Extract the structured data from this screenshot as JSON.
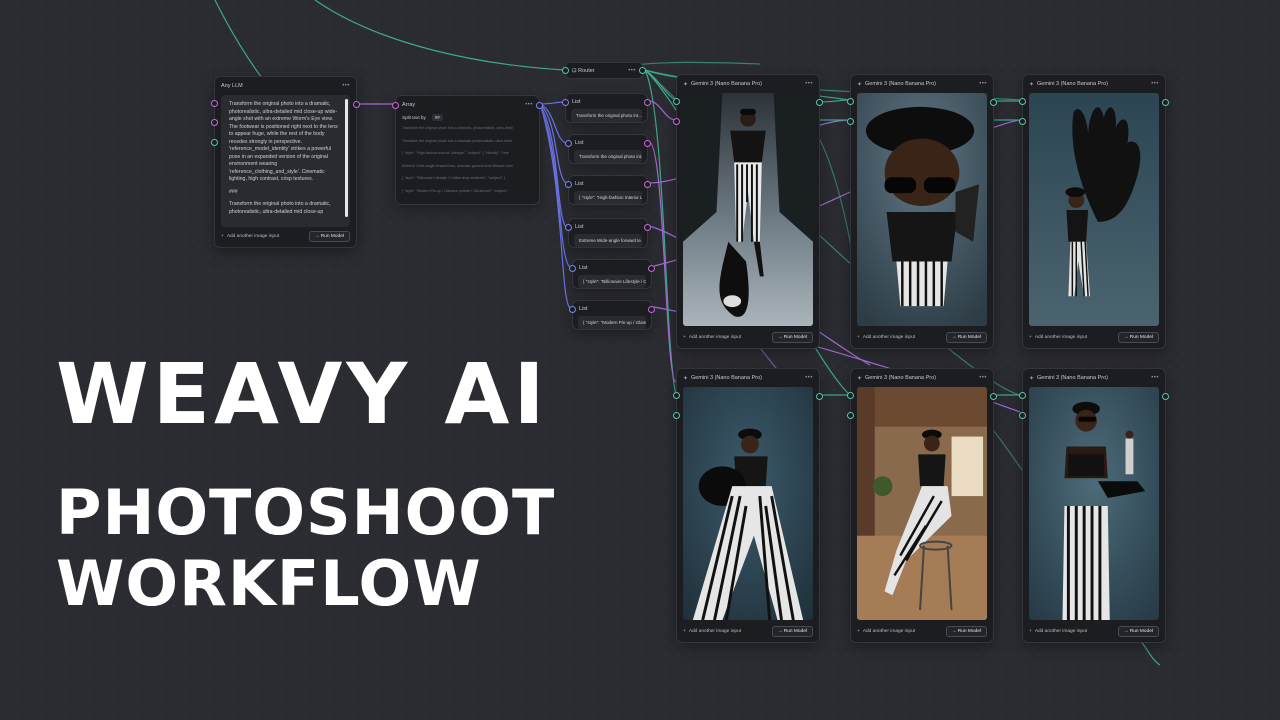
{
  "headline": {
    "line1": "WEAVY AI",
    "line2": "PHOTOSHOOT",
    "line3": "WORKFLOW"
  },
  "llm_node": {
    "title": "Any LLM",
    "paragraph1": "Transform the original photo into a dramatic, photorealistic, ultra-detailed mid close-up wide-angle shot with an extreme Worm's Eye view. The footwear is positioned right next to the lens to appear huge, while the rest of the body recedes strongly in perspective. 'reference_model_identity' strikes a powerful pose in an expanded version of the original environment wearing 'reference_clothing_and_style'. Cinematic lighting, high contrast, crisp textures.",
    "separator": "###",
    "paragraph2": "Transform the original photo into a dramatic, photorealistic, ultra-detailed mid close-up",
    "add_input": "Add another image input",
    "run_label": "Run Model",
    "menu_icon": "more-horizontal-icon"
  },
  "array_node": {
    "title": "Array",
    "split_label": "Split text by",
    "split_value": "##",
    "lines": [
      "Transform the original photo into a dramatic, photorealistic, ultra-detai",
      "Transform the original photo into a dramatic photorealistic, ultra-detai",
      "{ \"style\": \"High-fashion interior Lifestyle\", \"subject\": { \"identity\": \"refe",
      "Extreme Wide-angle forward lean, dramatic ground-level lifestyle shot",
      "{ \"style\": \"Billionaire Lifestyle / Coffee shop aesthetic\", \"subject\": {",
      "{ \"style\": \"Modern Pin-up / Glamour portrait / Old-school\", \"subject\":"
    ]
  },
  "router": {
    "title": "Router"
  },
  "list_nodes": [
    {
      "title": "List",
      "text": "Transform the original photo int..."
    },
    {
      "title": "List",
      "text": "Transform the original photo int..."
    },
    {
      "title": "List",
      "text": "{ \"style\": \"High-fashion Interior Li..."
    },
    {
      "title": "List",
      "text": "Extreme Wide-angle forward le..."
    },
    {
      "title": "List",
      "text": "{ \"style\": \"Billionaire Lifestyle / C..."
    },
    {
      "title": "List",
      "text": "{ \"style\": \"Modern Pin-up / Glam..."
    }
  ],
  "model_nodes": [
    {
      "title": "Gemini 3 (Nano Banana Pro)",
      "add_input": "Add another image input",
      "run_label": "Run Model"
    },
    {
      "title": "Gemini 3 (Nano Banana Pro)",
      "add_input": "Add another image input",
      "run_label": "Run Model"
    },
    {
      "title": "Gemini 3 (Nano Banana Pro)",
      "add_input": "Add another image input",
      "run_label": "Run Model"
    },
    {
      "title": "Gemini 3 (Nano Banana Pro)",
      "add_input": "Add another image input",
      "run_label": "Run Model"
    },
    {
      "title": "Gemini 3 (Nano Banana Pro)",
      "add_input": "Add another image input",
      "run_label": "Run Model"
    },
    {
      "title": "Gemini 3 (Nano Banana Pro)",
      "add_input": "Add another image input",
      "run_label": "Run Model"
    }
  ],
  "colors": {
    "background": "#2b2c31",
    "node": "#1c1d21",
    "port_pink": "#c56ad6",
    "port_teal": "#4fc9a8",
    "wire_teal": "#3fa88f",
    "wire_purple": "#a46bd6",
    "wire_blue": "#6a74e8",
    "accent": "#9a8cf5"
  }
}
